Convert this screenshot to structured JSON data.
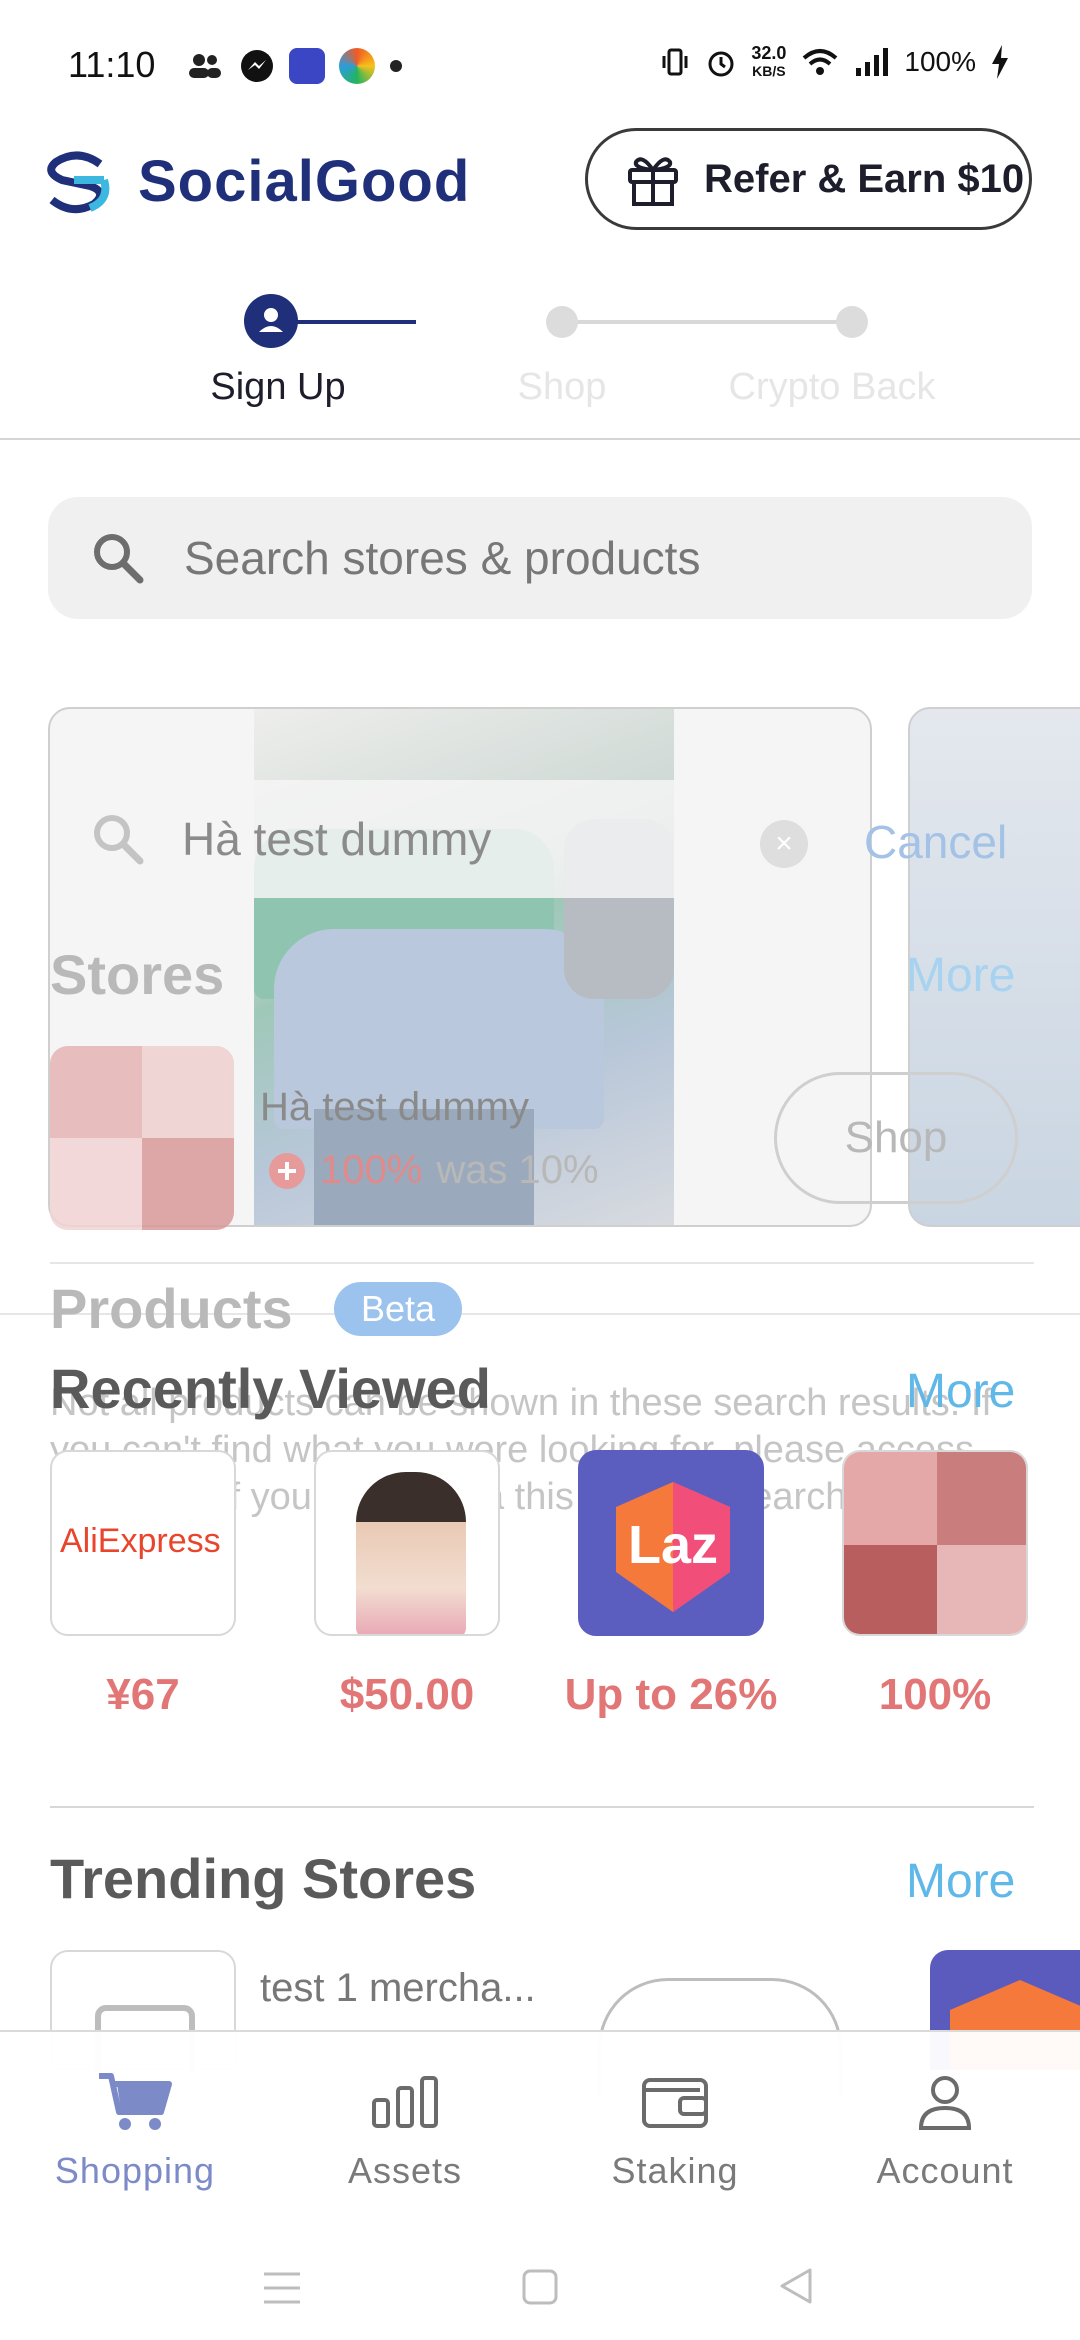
{
  "status_bar": {
    "time": "11:10",
    "net_speed_value": "32.0",
    "net_speed_unit": "KB/S",
    "battery": "100%"
  },
  "header": {
    "brand": "SocialGood",
    "refer_label": "Refer & Earn $10"
  },
  "stepper": {
    "steps": [
      "Sign Up",
      "Shop",
      "Crypto Back"
    ],
    "active_index": 0
  },
  "search": {
    "placeholder": "Search stores & products"
  },
  "overlay": {
    "query": "Hà test dummy",
    "cancel_label": "Cancel",
    "stores_title": "Stores",
    "stores_more": "More",
    "store": {
      "name": "Hà test dummy",
      "rate": "100%",
      "was": "was 10%",
      "shop_label": "Shop"
    },
    "products_title": "Products",
    "beta_label": "Beta",
    "note": "Not all products can be shown in these search results. If you can't find what you were looking for, please access the store of your choice via this app and search within their site."
  },
  "recently_viewed": {
    "title": "Recently Viewed",
    "more": "More",
    "items": [
      {
        "logo_text": "AliExpress",
        "label": "¥67"
      },
      {
        "logo_text": "",
        "label": "$50.00"
      },
      {
        "logo_text": "Laz",
        "label": "Up to 26%"
      },
      {
        "logo_text": "",
        "label": "100%"
      }
    ]
  },
  "trending": {
    "title": "Trending Stores",
    "more": "More",
    "first_store": "test 1 mercha..."
  },
  "bottom_nav": {
    "items": [
      "Shopping",
      "Assets",
      "Staking",
      "Account"
    ],
    "active_index": 0
  },
  "colors": {
    "brand_navy": "#1f2f7a",
    "accent_blue": "#5fb8e8",
    "price_red": "#e27676",
    "nav_active": "#7d8ac8"
  }
}
